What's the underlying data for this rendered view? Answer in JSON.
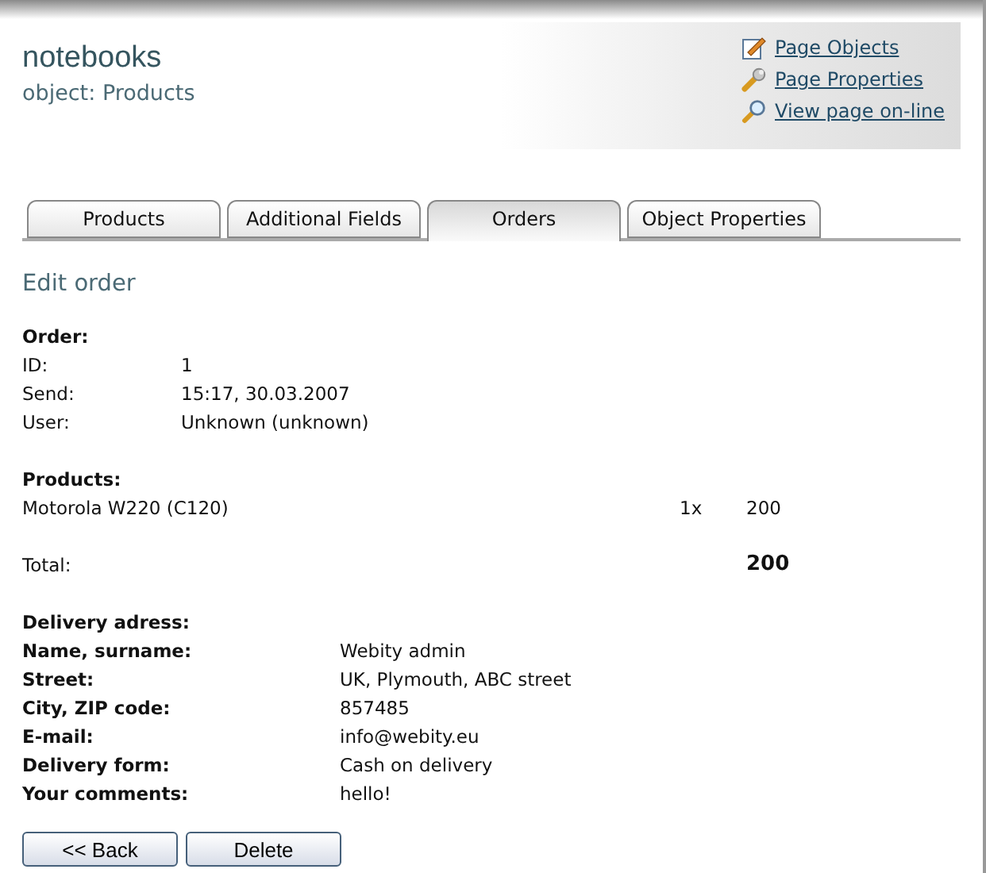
{
  "header": {
    "title": "notebooks",
    "subtitle": "object: Products"
  },
  "links": [
    {
      "kind": "edit",
      "label": "Page Objects"
    },
    {
      "kind": "wrench",
      "label": "Page Properties"
    },
    {
      "kind": "search",
      "label": "View page on-line"
    }
  ],
  "tabs": [
    {
      "label": "Products",
      "selected": false
    },
    {
      "label": "Additional Fields",
      "selected": false
    },
    {
      "label": "Orders",
      "selected": true
    },
    {
      "label": "Object Properties",
      "selected": false
    }
  ],
  "heading": "Edit order",
  "order": {
    "title": "Order:",
    "fields": [
      {
        "label": "ID:",
        "value": "1"
      },
      {
        "label": "Send:",
        "value": "15:17, 30.03.2007"
      },
      {
        "label": "User:",
        "value": "Unknown (unknown)"
      }
    ]
  },
  "products": {
    "title": "Products:",
    "items": [
      {
        "name": "Motorola W220 (C120)",
        "quantity": "1x",
        "price": "200"
      }
    ]
  },
  "total": {
    "label": "Total:",
    "value": "200"
  },
  "delivery": {
    "title": "Delivery adress:",
    "fields": [
      {
        "label": "Name, surname:",
        "value": "Webity admin"
      },
      {
        "label": "Street:",
        "value": "UK, Plymouth, ABC street"
      },
      {
        "label": "City, ZIP code:",
        "value": "857485"
      },
      {
        "label": "E-mail:",
        "value": "info@webity.eu"
      },
      {
        "label": "Delivery form:",
        "value": "Cash on delivery"
      },
      {
        "label": "Your comments:",
        "value": "hello!"
      }
    ]
  },
  "buttons": [
    "<< Back",
    "Delete"
  ]
}
